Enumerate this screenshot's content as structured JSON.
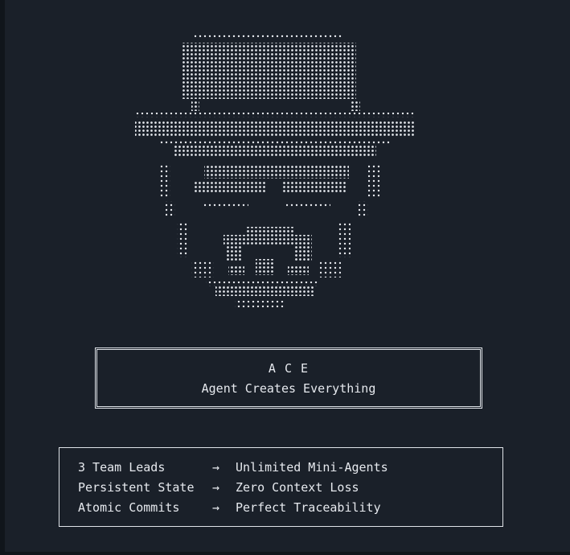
{
  "window": {
    "background": "#1a2029",
    "foreground": "#e6e9ee"
  },
  "ascii_art": {
    "subject": "hat-and-glasses-face-icon",
    "glyph": "braille-dots"
  },
  "title_box": {
    "title": "A C E",
    "subtitle": "Agent Creates Everything"
  },
  "features": [
    {
      "left": "3 Team Leads",
      "arrow": "→",
      "right": "Unlimited Mini-Agents"
    },
    {
      "left": "Persistent State",
      "arrow": "→",
      "right": "Zero Context Loss"
    },
    {
      "left": "Atomic Commits",
      "arrow": "→",
      "right": "Perfect Traceability"
    }
  ]
}
